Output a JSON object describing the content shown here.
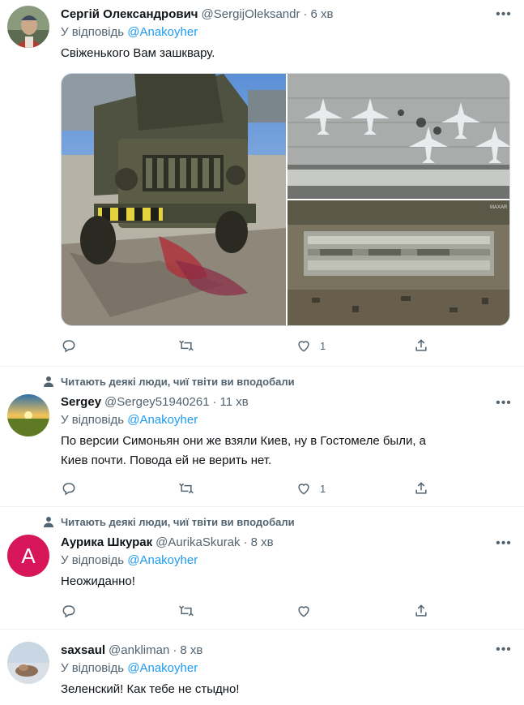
{
  "tweets": [
    {
      "name": "Сергій Олександрович",
      "handle": "@SergijOleksandr",
      "dot": "·",
      "time": "6 хв",
      "reply_prefix": "У відповідь",
      "reply_mention": "@Anakoyher",
      "text": "Свіженького Вам зашквару.",
      "likes": "1",
      "media_watermark": "MAXAR"
    },
    {
      "context": "Читають деякі люди, чиї твіти ви вподобали",
      "name": "Sergey",
      "handle": "@Sergey51940261",
      "dot": "·",
      "time": "11 хв",
      "reply_prefix": "У відповідь",
      "reply_mention": "@Anakoyher",
      "text_line1": "По версии Симоньян они же взяли Киев, ну в Гостомеле были, а",
      "text_line2": "Киев почти. Повода ей не верить нет.",
      "likes": "1"
    },
    {
      "context": "Читають деякі люди, чиї твіти ви вподобали",
      "avatar_letter": "A",
      "name": "Аурика Шкурак",
      "handle": "@AurikaSkurak",
      "dot": "·",
      "time": "8 хв",
      "reply_prefix": "У відповідь",
      "reply_mention": "@Anakoyher",
      "text": "Неожиданно!"
    },
    {
      "name": "saxsaul",
      "handle": "@ankliman",
      "dot": "·",
      "time": "8 хв",
      "reply_prefix": "У відповідь",
      "reply_mention": "@Anakoyher",
      "text": "Зеленский! Как тебе не стыдно!"
    }
  ],
  "colors": {
    "accent": "#1d9bf0",
    "secondary_text": "#536471",
    "avatar_a": "#d7165a"
  },
  "icons": [
    "more-icon",
    "reply-icon",
    "retweet-icon",
    "like-icon",
    "share-icon",
    "person-icon"
  ]
}
